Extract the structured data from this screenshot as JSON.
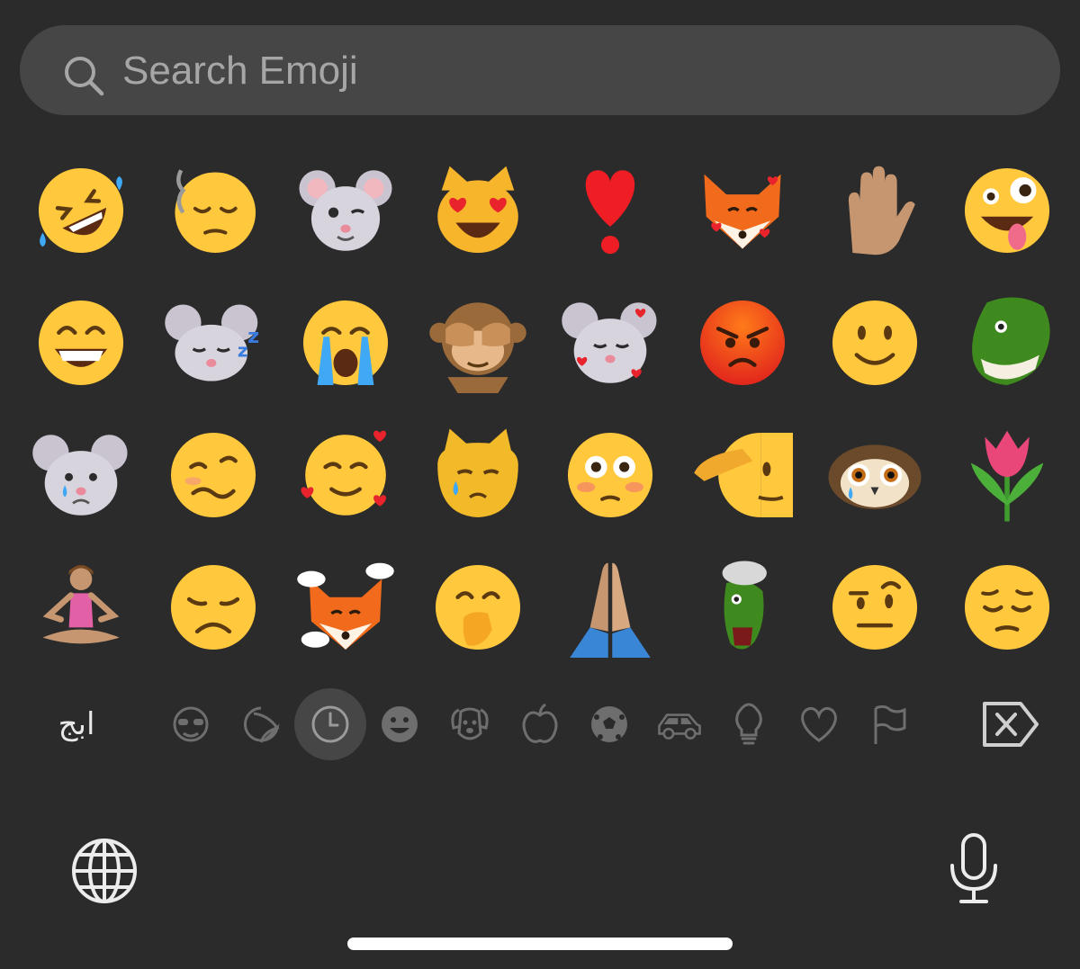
{
  "search": {
    "placeholder": "Search Emoji",
    "icon": "magnifier-icon"
  },
  "emojis": [
    {
      "name": "rolling-on-floor-laughing"
    },
    {
      "name": "face-exhaling"
    },
    {
      "name": "mouse-memoji-wink"
    },
    {
      "name": "smiling-cat-heart-eyes"
    },
    {
      "name": "heart-exclamation"
    },
    {
      "name": "fox-memoji-hearts"
    },
    {
      "name": "raised-hand"
    },
    {
      "name": "zany-face"
    },
    {
      "name": "beaming-face"
    },
    {
      "name": "mouse-memoji-sleeping"
    },
    {
      "name": "loudly-crying-face"
    },
    {
      "name": "see-no-evil-monkey"
    },
    {
      "name": "mouse-memoji-hearts"
    },
    {
      "name": "angry-face"
    },
    {
      "name": "slightly-smiling-face"
    },
    {
      "name": "t-rex-memoji"
    },
    {
      "name": "mouse-memoji-crying"
    },
    {
      "name": "woozy-face"
    },
    {
      "name": "smiling-face-with-hearts"
    },
    {
      "name": "crying-cat"
    },
    {
      "name": "flushed-face"
    },
    {
      "name": "saluting-face"
    },
    {
      "name": "owl-memoji-crying"
    },
    {
      "name": "tulip"
    },
    {
      "name": "person-in-lotus-position"
    },
    {
      "name": "disappointed-face"
    },
    {
      "name": "fox-memoji-clouds"
    },
    {
      "name": "face-with-hand-over-mouth"
    },
    {
      "name": "folded-hands"
    },
    {
      "name": "t-rex-memoji-mind-blown"
    },
    {
      "name": "face-with-raised-eyebrow"
    },
    {
      "name": "pensive-face"
    }
  ],
  "keyboard": {
    "abc_label": "ابج",
    "categories": [
      {
        "icon": "memoji-icon"
      },
      {
        "icon": "sticker-icon"
      },
      {
        "icon": "clock-icon"
      },
      {
        "icon": "smiley-icon"
      },
      {
        "icon": "dog-icon"
      },
      {
        "icon": "apple-icon"
      },
      {
        "icon": "soccer-ball-icon"
      },
      {
        "icon": "car-icon"
      },
      {
        "icon": "lightbulb-icon"
      },
      {
        "icon": "heart-icon"
      },
      {
        "icon": "flag-icon"
      }
    ],
    "selected_category": "clock-icon",
    "delete_icon": "delete-icon",
    "globe_icon": "globe-icon",
    "mic_icon": "microphone-icon"
  }
}
